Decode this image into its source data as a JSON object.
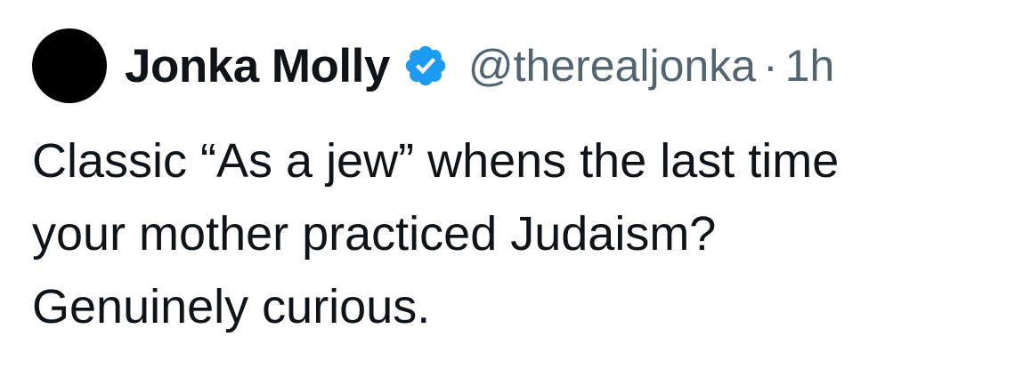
{
  "tweet": {
    "author": {
      "display_name": "Jonka Molly",
      "handle": "@therealjonka",
      "verified": true,
      "avatar_color": "#000000"
    },
    "separator": "·",
    "timestamp": "1h",
    "text_lines": [
      "Classic “As a jew” whens the last time",
      "your mother practiced Judaism?",
      "Genuinely curious."
    ]
  },
  "colors": {
    "text_primary": "#0f1419",
    "text_secondary": "#536471",
    "verified_blue": "#1d9bf0"
  },
  "icons": {
    "verified": "verified-badge-icon"
  }
}
